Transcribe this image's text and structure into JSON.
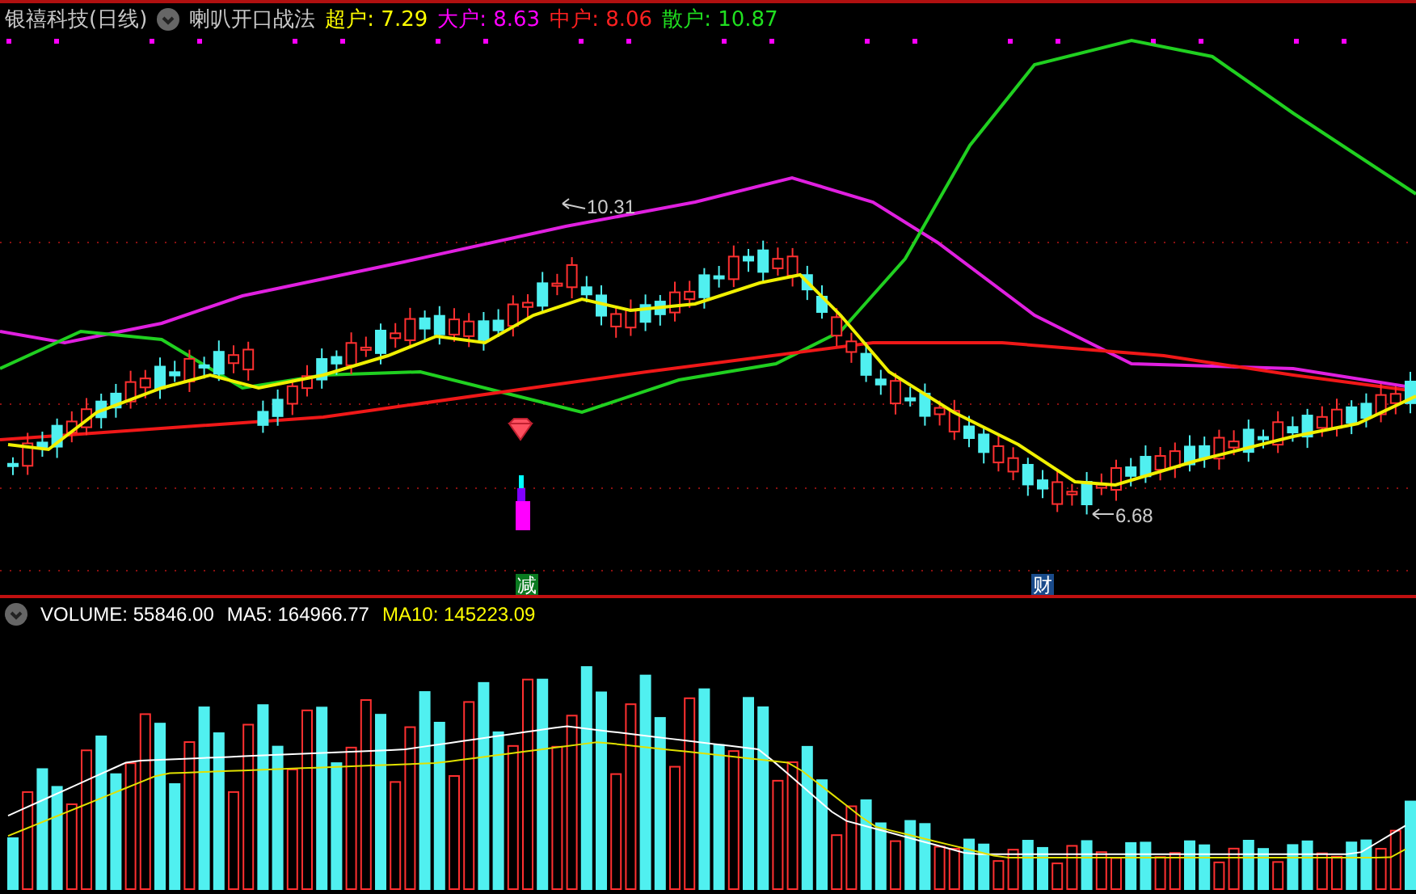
{
  "header": {
    "stock": "银禧科技(日线)",
    "indicator": "喇叭开口战法",
    "legend": [
      {
        "text": "超户: 7.29",
        "color": "#ffff00"
      },
      {
        "text": "大户: 8.63",
        "color": "#ff00ff"
      },
      {
        "text": "中户: 8.06",
        "color": "#ff2020"
      },
      {
        "text": "散户: 10.87",
        "color": "#20e020"
      }
    ]
  },
  "main_chart": {
    "high_label": "10.31",
    "low_label": "6.68",
    "markers": [
      {
        "text": "减",
        "color": "#0a7a20"
      },
      {
        "text": "财",
        "color": "#1a4a8a"
      }
    ]
  },
  "volume": {
    "legend": [
      {
        "text": "VOLUME: 55846.00",
        "color": "#ffffff"
      },
      {
        "text": "MA5: 164966.77",
        "color": "#ffffff"
      },
      {
        "text": "MA10: 145223.09",
        "color": "#ffff00"
      }
    ]
  }
}
